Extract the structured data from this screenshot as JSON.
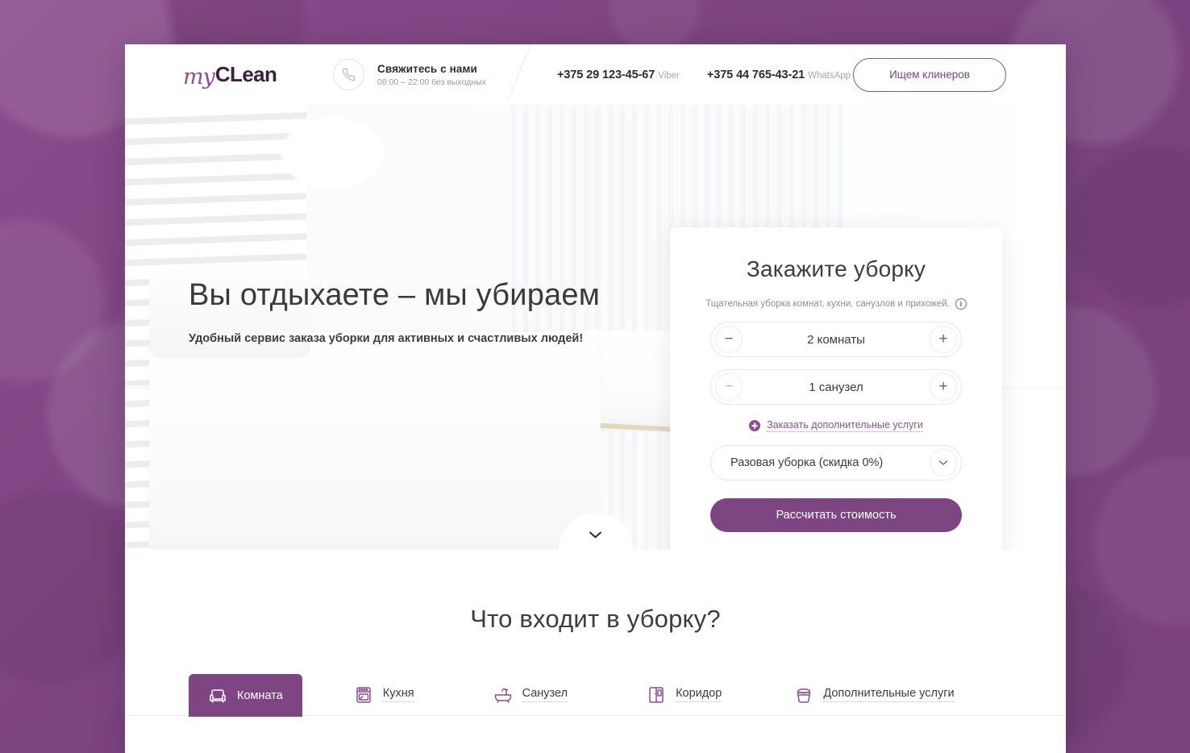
{
  "brand": {
    "logo_script": "my",
    "logo_bold": "CLean"
  },
  "header": {
    "contact_title": "Свяжитесь с нами",
    "contact_hours": "08:00 – 22:00 без выходных",
    "phones": [
      {
        "number": "+375 29 123-45-67",
        "tag": "Viber"
      },
      {
        "number": "+375 44 765-43-21",
        "tag": "WhatsApp"
      }
    ],
    "cta_label": "Ищем клинеров",
    "phone_icon": "phone-icon"
  },
  "hero": {
    "title": "Вы отдыхаете – мы убираем",
    "subtitle": "Удобный сервис заказа уборки для активных и счастливых людей!",
    "scroll_icon": "chevron-down-icon"
  },
  "order_form": {
    "title": "Закажите уборку",
    "note": "Тщательная уборка комнат, кухни, санузлов и прихожей.",
    "info_icon": "info-icon",
    "info_glyph": "i",
    "steppers": [
      {
        "name": "rooms",
        "value": "2 комнаты",
        "minus": "−",
        "plus": "+",
        "minus_state": "active",
        "plus_state": "active"
      },
      {
        "name": "bathrooms",
        "value": "1 санузел",
        "minus": "−",
        "plus": "+",
        "minus_state": "muted",
        "plus_state": "active"
      }
    ],
    "extra_services_label": "Заказать дополнительные услуги",
    "extra_services_icon": "plus-circle-icon",
    "frequency_selected": "Разовая уборка (скидка 0%)",
    "frequency_icon": "chevron-down-icon",
    "submit_label": "Рассчитать стоимость"
  },
  "services_section": {
    "title": "Что входит в уборку?",
    "tabs": [
      {
        "label": "Комната",
        "icon": "armchair-icon",
        "active": true
      },
      {
        "label": "Кухня",
        "icon": "oven-icon",
        "active": false
      },
      {
        "label": "Санузел",
        "icon": "bathtub-icon",
        "active": false
      },
      {
        "label": "Коридор",
        "icon": "wardrobe-icon",
        "active": false
      },
      {
        "label": "Дополнительные услуги",
        "icon": "bucket-icon",
        "active": false
      }
    ]
  },
  "colors": {
    "brand_purple": "#7d4582",
    "brand_purple_light": "#8b4f8f",
    "page_background": "#7d4582",
    "text_dark": "#3d3d3d",
    "text_muted": "#9a9a9a"
  }
}
